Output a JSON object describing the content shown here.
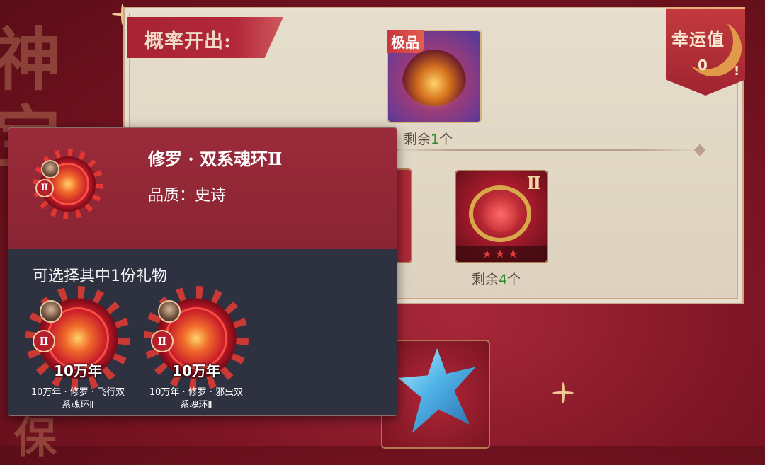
{
  "background": {
    "left_glyphs": "神\n宝",
    "bottom_glyph": "保"
  },
  "probability_panel": {
    "label": "概率开出:",
    "top_item": {
      "tag": "极品",
      "remaining_prefix": "剩余",
      "remaining_count": "1",
      "remaining_suffix": "个"
    },
    "mid_item": {
      "roman": "Ⅱ",
      "stars": "★★★",
      "remaining_prefix": "剩余",
      "remaining_count": "4",
      "remaining_suffix": "个"
    }
  },
  "luck": {
    "label": "幸运值",
    "value": "0",
    "info": "!"
  },
  "tooltip": {
    "title": "修罗 · 双系魂环Ⅱ",
    "quality": "品质：史诗",
    "icon_roman": "Ⅱ",
    "choose_label": "可选择其中1份礼物",
    "gifts": [
      {
        "year": "10万年",
        "roman": "Ⅱ",
        "name_line1": "10万年 · 修罗 · 飞行双",
        "name_line2": "系魂环Ⅱ"
      },
      {
        "year": "10万年",
        "roman": "Ⅱ",
        "name_line1": "10万年 · 修罗 · 邪虫双",
        "name_line2": "系魂环Ⅱ"
      }
    ]
  },
  "colors": {
    "panel": "#e1d6c4",
    "ribbon": "#a82334",
    "tooltip_head": "#922838",
    "tooltip_body": "#2e3240",
    "remaining_number": "#2f8a2f"
  }
}
